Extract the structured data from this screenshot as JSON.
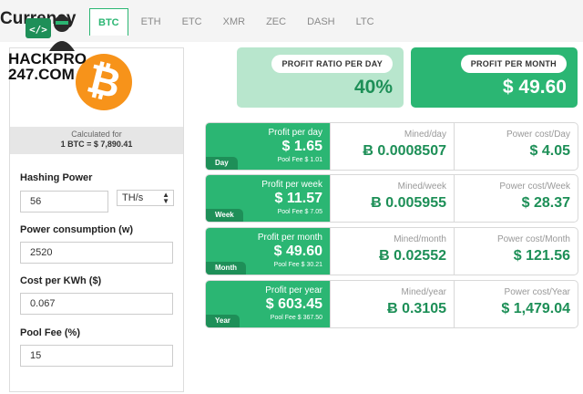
{
  "header": {
    "title": "Currency",
    "tabs": [
      {
        "label": "BTC",
        "active": true
      },
      {
        "label": "ETH"
      },
      {
        "label": "ETC"
      },
      {
        "label": "XMR"
      },
      {
        "label": "ZEC"
      },
      {
        "label": "DASH"
      },
      {
        "label": "LTC"
      }
    ]
  },
  "watermark": {
    "line1": "HACKPRO",
    "line2": "247.COM"
  },
  "coin": {
    "symbol": "₿",
    "calculated_for": "Calculated for",
    "rate": "1 BTC = $ 7,890.41"
  },
  "form": {
    "hashing_power": {
      "label": "Hashing Power",
      "value": "56",
      "unit": "TH/s"
    },
    "power_consumption": {
      "label": "Power consumption (w)",
      "value": "2520"
    },
    "cost_per_kwh": {
      "label": "Cost per KWh ($)",
      "value": "0.067"
    },
    "pool_fee": {
      "label": "Pool Fee (%)",
      "value": "15"
    }
  },
  "summary": {
    "ratio": {
      "label": "PROFIT RATIO PER DAY",
      "value": "40%"
    },
    "month": {
      "label": "PROFIT PER MONTH",
      "value": "$ 49.60"
    }
  },
  "rows": [
    {
      "tag": "Day",
      "profit_label": "Profit per day",
      "profit": "$ 1.65",
      "fee": "Pool Fee $ 1.01",
      "mined_label": "Mined/day",
      "mined": "Ƀ 0.0008507",
      "power_label": "Power cost/Day",
      "power": "$ 4.05"
    },
    {
      "tag": "Week",
      "profit_label": "Profit per week",
      "profit": "$ 11.57",
      "fee": "Pool Fee $ 7.05",
      "mined_label": "Mined/week",
      "mined": "Ƀ 0.005955",
      "power_label": "Power cost/Week",
      "power": "$ 28.37"
    },
    {
      "tag": "Month",
      "profit_label": "Profit per month",
      "profit": "$ 49.60",
      "fee": "Pool Fee $ 30.21",
      "mined_label": "Mined/month",
      "mined": "Ƀ 0.02552",
      "power_label": "Power cost/Month",
      "power": "$ 121.56"
    },
    {
      "tag": "Year",
      "profit_label": "Profit per year",
      "profit": "$ 603.45",
      "fee": "Pool Fee $ 367.50",
      "mined_label": "Mined/year",
      "mined": "Ƀ 0.3105",
      "power_label": "Power cost/Year",
      "power": "$ 1,479.04"
    }
  ],
  "colors": {
    "accent": "#2bb673",
    "accent_light": "#b8e6cd",
    "bitcoin": "#f7931a"
  }
}
